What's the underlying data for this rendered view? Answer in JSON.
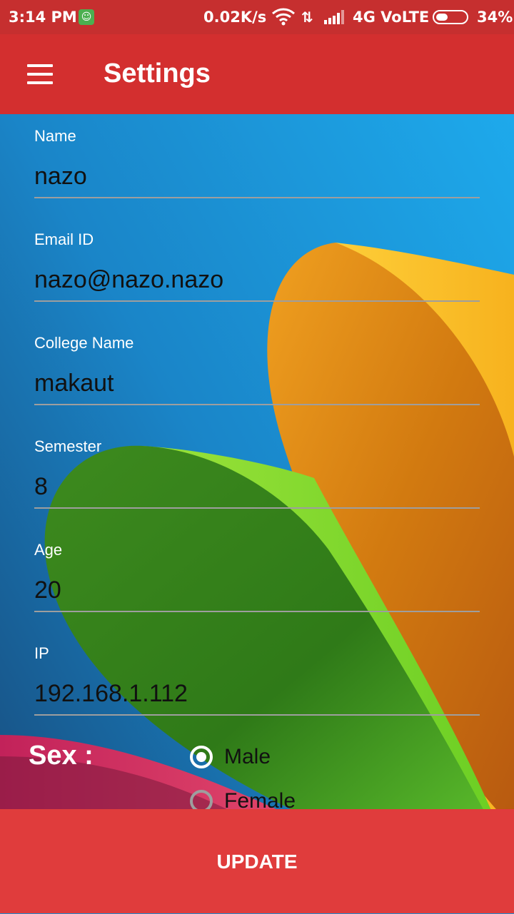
{
  "status_bar": {
    "time": "3:14 PM",
    "net_speed": "0.02K/s",
    "network": "4G VoLTE",
    "battery": "34%",
    "icons": [
      "notification-app-icon",
      "wifi-icon",
      "data-arrows-icon",
      "signal-icon",
      "battery-icon"
    ]
  },
  "app_bar": {
    "title": "Settings",
    "menu_icon": "hamburger-menu-icon"
  },
  "form": {
    "fields": [
      {
        "label": "Name",
        "value": "nazo"
      },
      {
        "label": "Email ID",
        "value": "nazo@nazo.nazo"
      },
      {
        "label": "College Name",
        "value": "makaut"
      },
      {
        "label": "Semester",
        "value": "8"
      },
      {
        "label": "Age",
        "value": "20"
      },
      {
        "label": "IP",
        "value": "192.168.1.112"
      }
    ],
    "sex": {
      "label": "Sex :",
      "options": [
        "Male",
        "Female"
      ],
      "selected": "Male"
    }
  },
  "update_button": "UPDATE",
  "colors": {
    "status_bar": "#c62f2f",
    "app_bar": "#d32f2f",
    "button": "#e03c3c"
  }
}
